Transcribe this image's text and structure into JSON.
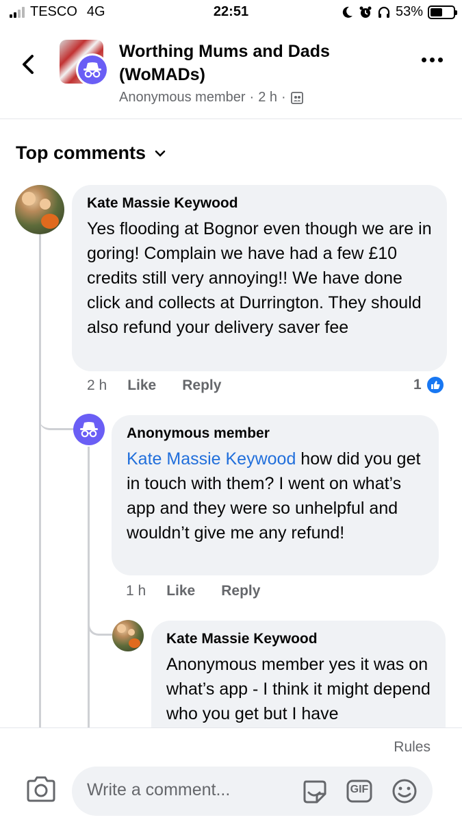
{
  "status_bar": {
    "carrier": "TESCO",
    "network": "4G",
    "time": "22:51",
    "battery": "53%",
    "battery_level": 0.53,
    "icons": [
      "signal-icon",
      "moon-icon",
      "alarm-icon",
      "headphones-icon",
      "battery-icon"
    ]
  },
  "header": {
    "group_name": "Worthing Mums and Dads (WoMADs)",
    "author": "Anonymous member",
    "time": "2 h",
    "separator": "·",
    "icons": [
      "back-arrow-icon",
      "group-avatar",
      "anonymous-icon",
      "members-privacy-icon",
      "more-options-icon"
    ]
  },
  "comments_section": {
    "sort_label": "Top comments",
    "sort_icon": "chevron-down-icon"
  },
  "comments": [
    {
      "author": "Kate Massie Keywood",
      "text": "Yes flooding at Bognor even though we are in goring! Complain we have had a few £10 credits still very annoying!! We have done click and collects at Durrington. They should also refund your delivery saver fee",
      "time": "2 h",
      "like_label": "Like",
      "reply_label": "Reply",
      "reaction_count": "1"
    },
    {
      "author": "Anonymous member",
      "mention": "Kate Massie Keywood",
      "text": " how did you get in touch with them? I went on what’s app and they were so unhelpful and wouldn’t give me any refund!",
      "time": "1 h",
      "like_label": "Like",
      "reply_label": "Reply"
    },
    {
      "author": "Kate Massie Keywood",
      "text": "Anonymous member yes it was on what’s app - I think it might depend who you get but I have"
    }
  ],
  "composer": {
    "rules_label": "Rules",
    "placeholder": "Write a comment...",
    "gif_label": "GIF",
    "icons": [
      "camera-icon",
      "sticker-icon",
      "gif-icon",
      "emoji-icon"
    ]
  },
  "colors": {
    "link": "#216fdb",
    "anonymous": "#6a5ef5",
    "bubble": "#f0f2f5",
    "secondary_text": "#65676b",
    "like_blue": "#1877f2"
  }
}
